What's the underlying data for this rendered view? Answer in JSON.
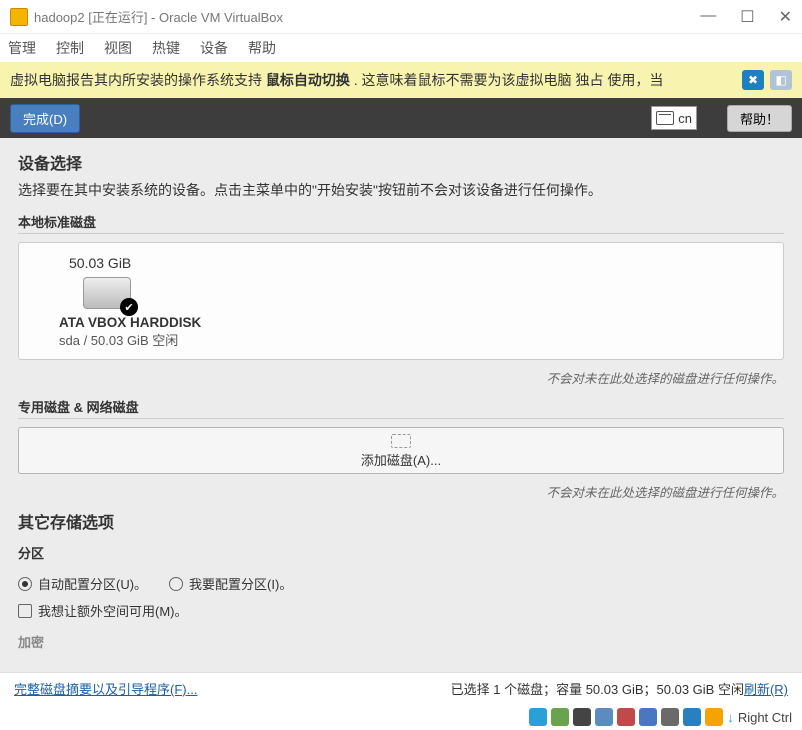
{
  "window": {
    "title": "hadoop2 [正在运行] - Oracle VM VirtualBox"
  },
  "menubar": [
    "管理",
    "控制",
    "视图",
    "热键",
    "设备",
    "帮助"
  ],
  "capture": {
    "pre": "虚拟电脑报告其内所安装的操作系统支持 ",
    "bold": "鼠标自动切换",
    "post": ".   这意味着鼠标不需要为该虚拟电脑 独占 使用，当 "
  },
  "topbar": {
    "done": "完成(D)",
    "ime": "cn",
    "help": "帮助！"
  },
  "install": {
    "title": "设备选择",
    "desc": "选择要在其中安装系统的设备。点击主菜单中的\"开始安装\"按钮前不会对该设备进行任何操作。",
    "local_head": "本地标准磁盘",
    "disk": {
      "size": "50.03 GiB",
      "name": "ATA VBOX HARDDISK",
      "status": "sda  /  50.03 GiB 空闲"
    },
    "note": "不会对未在此处选择的磁盘进行任何操作。",
    "special_head": "专用磁盘 & 网络磁盘",
    "add_disk": "添加磁盘(A)...",
    "other_head": "其它存储选项",
    "partition_head": "分区",
    "radio_auto": "自动配置分区(U)。",
    "radio_manual": "我要配置分区(I)。",
    "check_extra": "我想让额外空间可用(M)。",
    "encrypt_head": "加密"
  },
  "footer": {
    "summary_link": "完整磁盘摘要以及引导程序(F)...",
    "status": "已选择 1 个磁盘；容量 50.03 GiB；50.03 GiB 空闲 ",
    "refresh": "刷新(R)"
  },
  "statusbar": {
    "hostkey": "Right Ctrl"
  }
}
